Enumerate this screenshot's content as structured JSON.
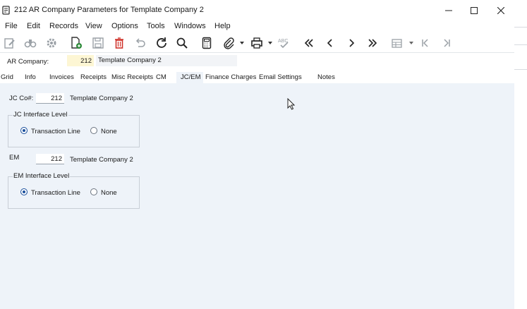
{
  "window": {
    "title": "212 AR Company Parameters for Template Company 2",
    "minimize_glyph": "minimize-icon",
    "maximize_glyph": "maximize-icon",
    "close_glyph": "close-icon"
  },
  "menu": [
    "File",
    "Edit",
    "Records",
    "View",
    "Options",
    "Tools",
    "Windows",
    "Help"
  ],
  "toolbar_icons": [
    "edit-form-icon",
    "find-icon",
    "settings-icon",
    "new-record-icon",
    "save-icon",
    "delete-icon",
    "undo-icon",
    "refresh-icon",
    "search-icon",
    "calculator-icon",
    "attachment-icon",
    "print-icon",
    "spell-check-icon",
    "first-record-icon",
    "previous-record-icon",
    "next-record-icon",
    "last-record-icon",
    "grid-view-icon",
    "first-page-icon",
    "last-page-icon"
  ],
  "header": {
    "company_label": "AR Company:",
    "company_value": "212",
    "company_name": "Template Company 2"
  },
  "tabs": [
    "Grid",
    "Info",
    "Invoices",
    "Receipts",
    "Misc Receipts",
    "CM",
    "JC/EM",
    "Finance Charges",
    "Email Settings",
    "Notes"
  ],
  "active_tab": "JC/EM",
  "jc": {
    "label": "JC Co#:",
    "value": "212",
    "company_name": "Template Company 2",
    "group_title": "JC Interface Level",
    "options": [
      "Transaction Line",
      "None"
    ],
    "selected": "Transaction Line"
  },
  "em": {
    "label": "EM",
    "value": "212",
    "company_name": "Template Company 2",
    "group_title": "EM Interface Level",
    "options": [
      "Transaction Line",
      "None"
    ],
    "selected": "Transaction Line"
  },
  "colors": {
    "content_bg": "#eef3f9",
    "company_input_bg": "#fdf6d4",
    "delete_icon": "#d0342c",
    "radio_accent": "#1a4f9c"
  }
}
